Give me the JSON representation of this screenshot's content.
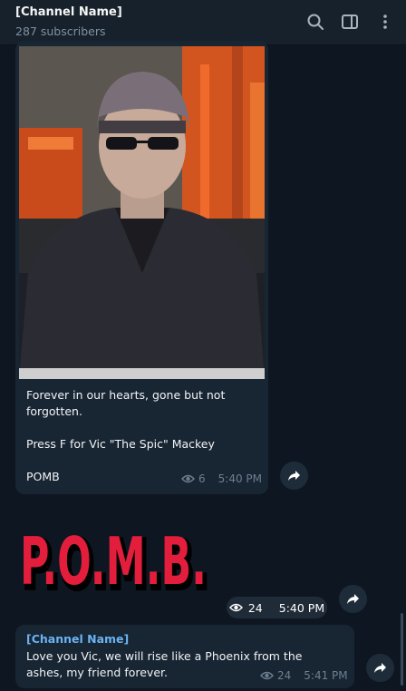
{
  "header": {
    "title": "[Channel Name]",
    "subscribers": "287 subscribers",
    "icons": [
      "search-icon",
      "sidebar-toggle-icon",
      "more-vertical-icon"
    ]
  },
  "messages": [
    {
      "type": "photo",
      "caption_lines": [
        "Forever in our hearts, gone but not",
        "forgotten.",
        "",
        "Press F for Vic \"The Spic\" Mackey",
        "",
        "POMB"
      ],
      "views": "6",
      "time": "5:40 PM"
    },
    {
      "type": "sticker",
      "sticker_text": "P.O.M.B.",
      "views": "24",
      "time": "5:40 PM"
    },
    {
      "type": "text",
      "sender": "[Channel Name]",
      "text": "Love you Vic, we will rise like a Phoenix from the ashes, my friend forever.",
      "views": "24",
      "time": "5:41 PM"
    }
  ],
  "colors": {
    "background": "#0e1621",
    "header": "#17212b",
    "bubble": "#182533",
    "accent_name": "#6ab3f3",
    "meta_text": "#6d7f8f",
    "sticker_red": "#e21e3c"
  }
}
